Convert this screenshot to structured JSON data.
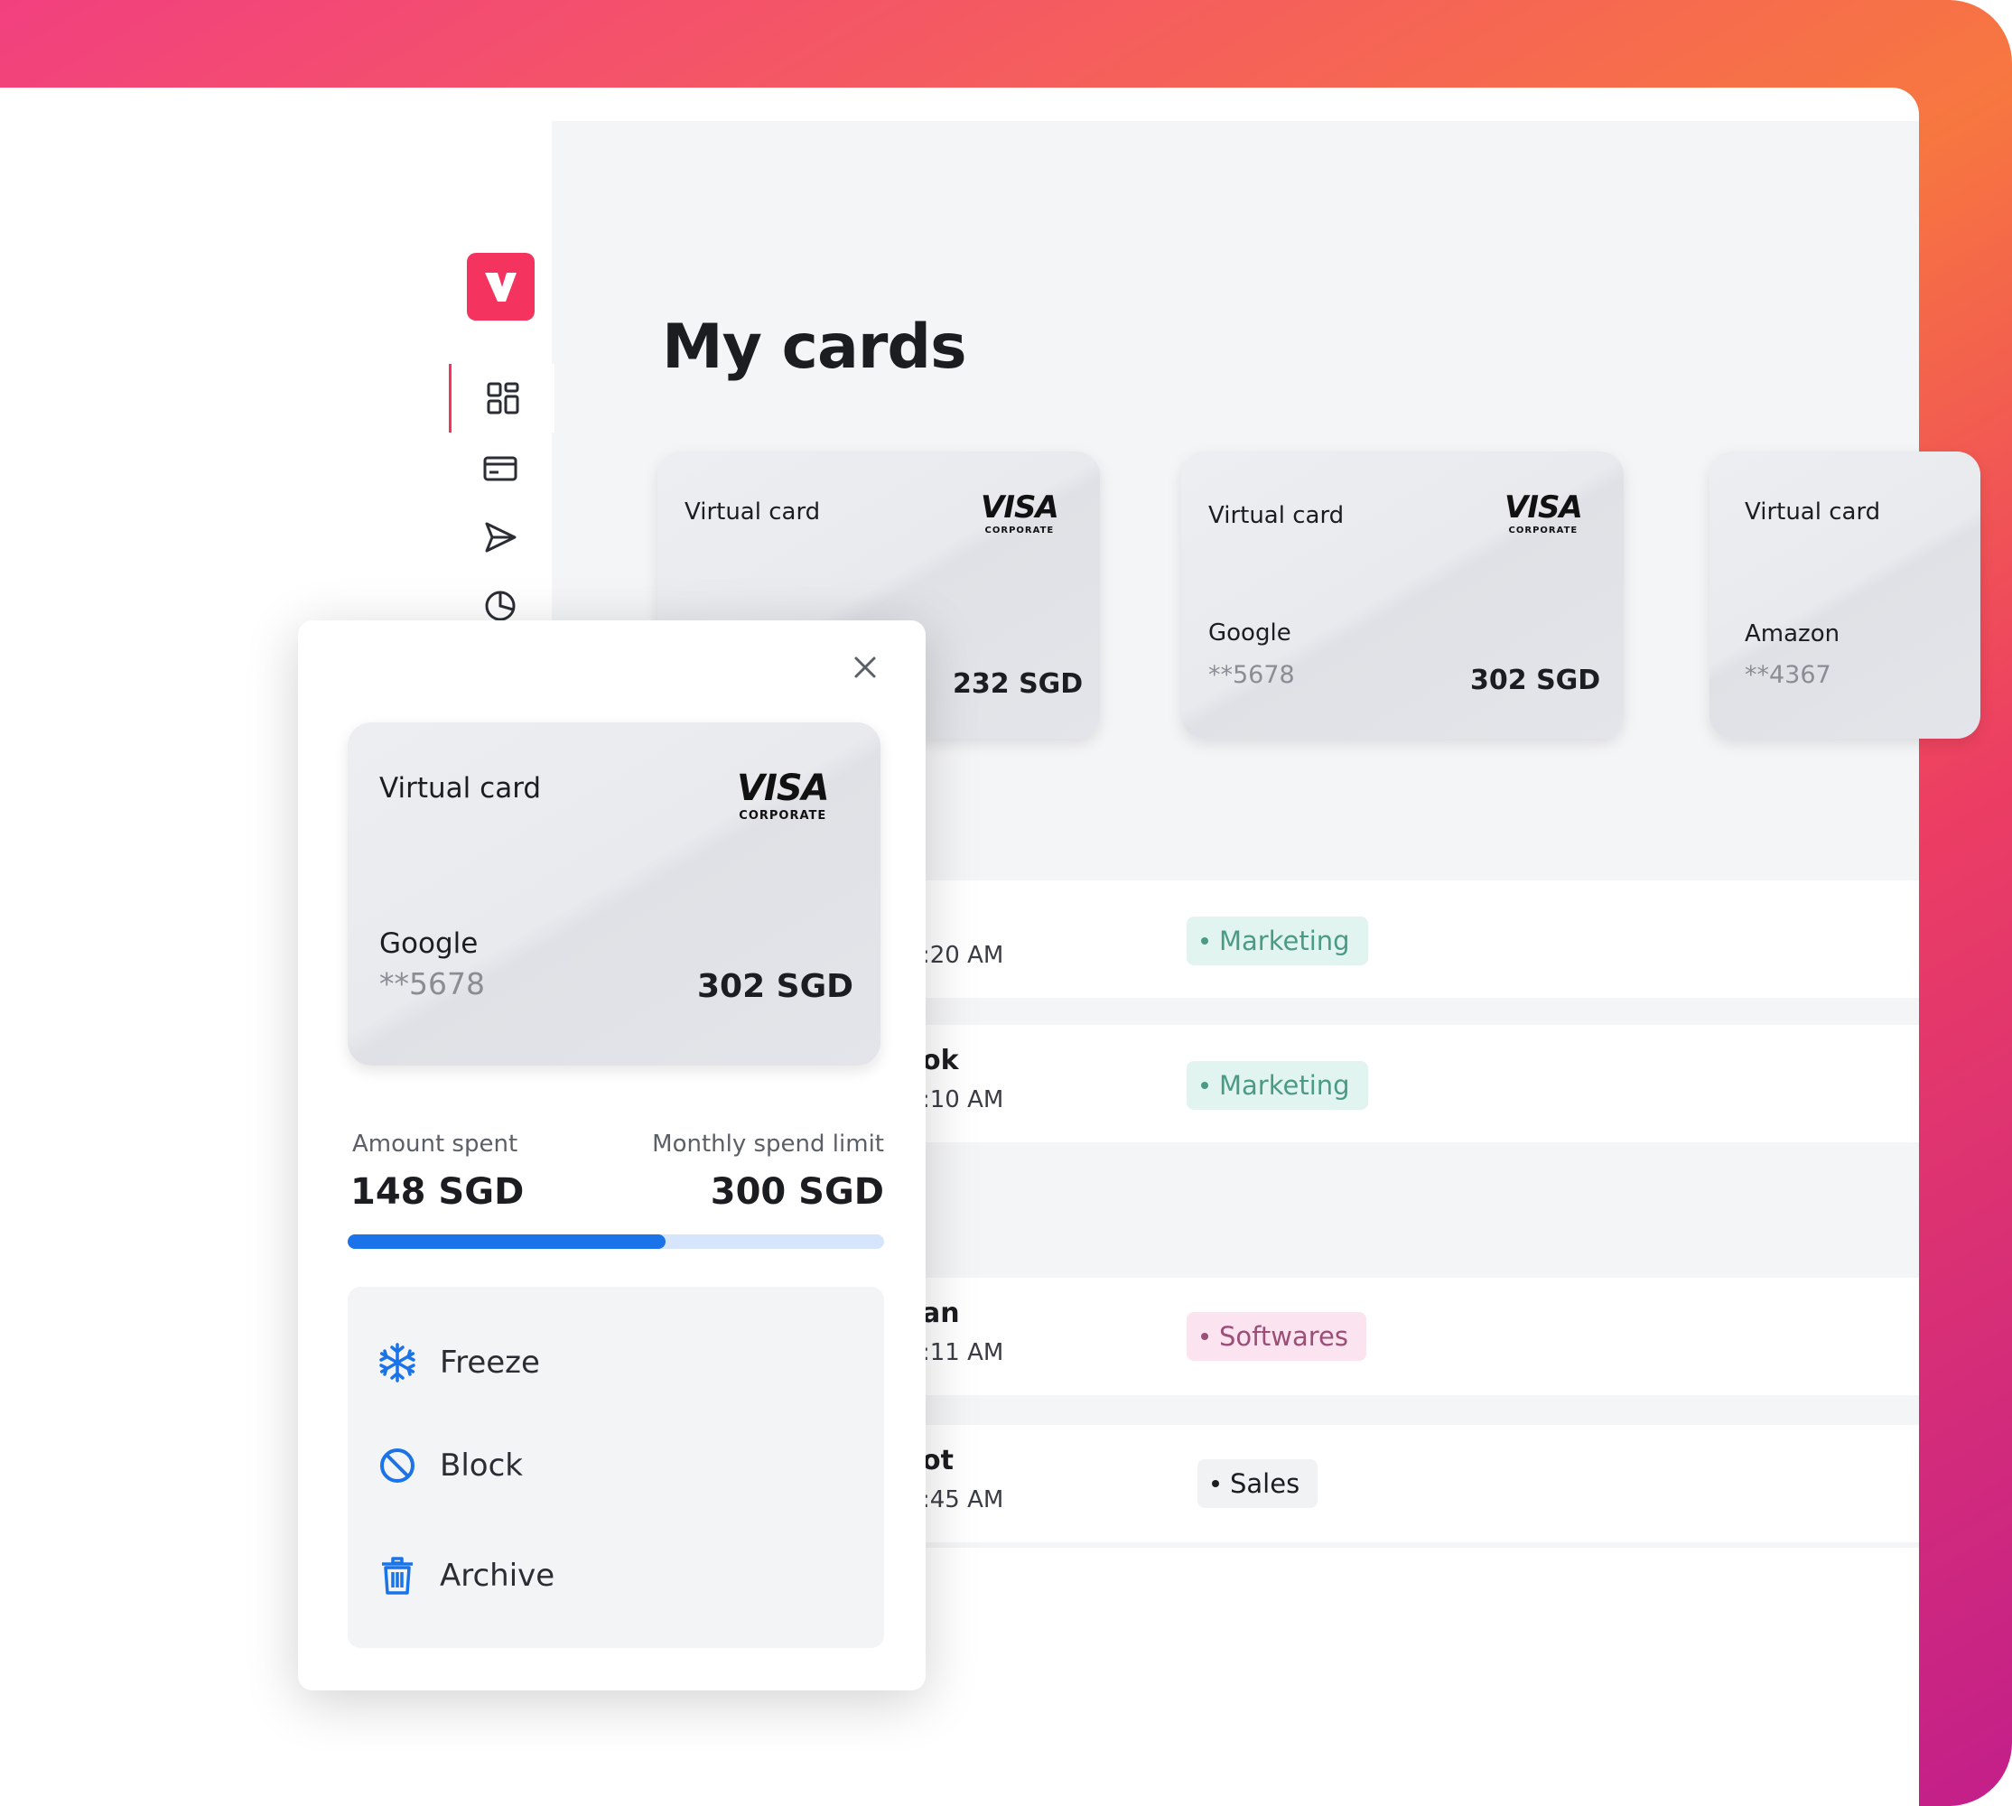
{
  "page": {
    "title": "My cards"
  },
  "colors": {
    "accent": "#f5335f",
    "progress": "#1a73e8",
    "progress_track": "#d6e5fb"
  },
  "sidebar": {
    "logo_icon": "brand-v-logo",
    "items": [
      {
        "icon": "dashboard-grid-icon",
        "active": true
      },
      {
        "icon": "card-icon",
        "active": false
      },
      {
        "icon": "send-icon",
        "active": false
      },
      {
        "icon": "pie-chart-icon",
        "active": false
      }
    ]
  },
  "cards": [
    {
      "type": "Virtual card",
      "brand": "VISA",
      "brand_sub": "CORPORATE",
      "merchant": "",
      "masked": "",
      "amount": "232 SGD"
    },
    {
      "type": "Virtual card",
      "brand": "VISA",
      "brand_sub": "CORPORATE",
      "merchant": "Google",
      "masked": "**5678",
      "amount": "302 SGD"
    },
    {
      "type": "Virtual card",
      "brand": "",
      "brand_sub": "",
      "merchant": "Amazon",
      "masked": "**4367",
      "amount": ""
    }
  ],
  "transactions": [
    {
      "name": "",
      "time": ":20 AM",
      "tag": "Marketing"
    },
    {
      "name": "ok",
      "time": ":10 AM",
      "tag": "Marketing"
    },
    {
      "name": "an",
      "time": ":11 AM",
      "tag": "Softwares"
    },
    {
      "name": "ot",
      "time": ":45 AM",
      "tag": "Sales"
    }
  ],
  "popup": {
    "card": {
      "type": "Virtual card",
      "brand": "VISA",
      "brand_sub": "CORPORATE",
      "merchant": "Google",
      "masked": "**5678",
      "amount": "302 SGD"
    },
    "amount_spent_label": "Amount spent",
    "amount_spent_value": "148 SGD",
    "limit_label": "Monthly spend limit",
    "limit_value": "300 SGD",
    "spent_fraction": 0.593,
    "actions": [
      {
        "label": "Freeze",
        "icon": "snowflake-icon"
      },
      {
        "label": "Block",
        "icon": "block-icon"
      },
      {
        "label": "Archive",
        "icon": "trash-icon"
      }
    ]
  }
}
